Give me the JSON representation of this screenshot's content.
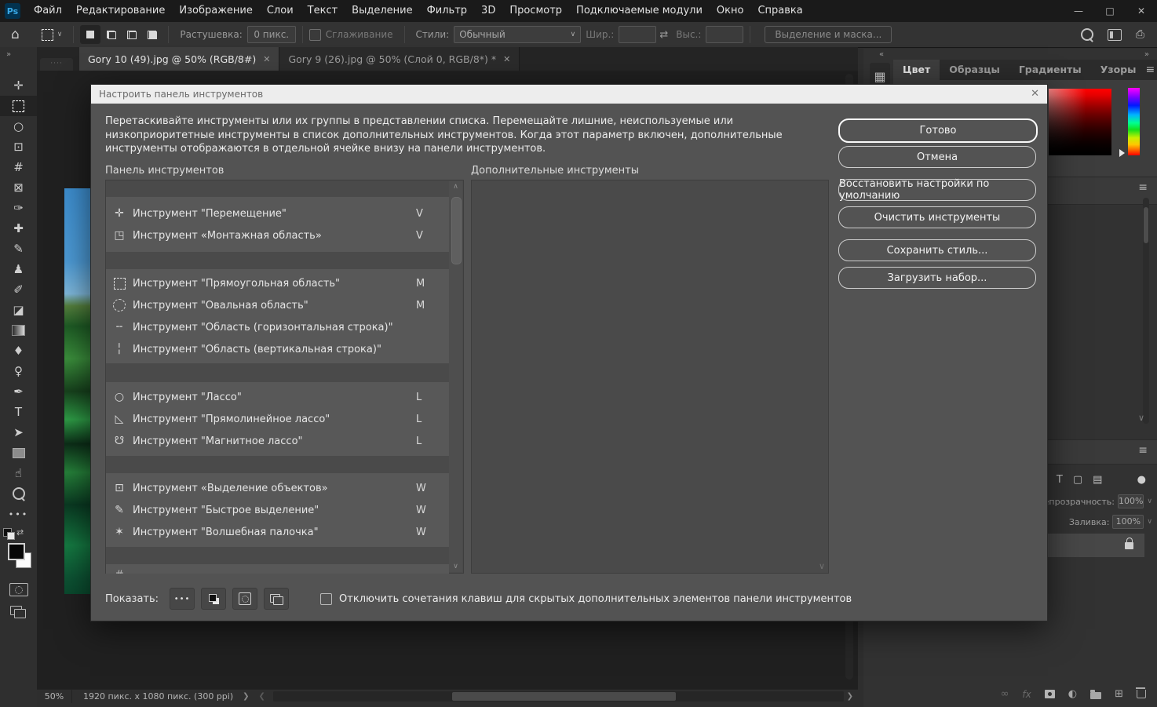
{
  "titlebar": {
    "logo": "Ps",
    "menus": [
      "Файл",
      "Редактирование",
      "Изображение",
      "Слои",
      "Текст",
      "Выделение",
      "Фильтр",
      "3D",
      "Просмотр",
      "Подключаемые модули",
      "Окно",
      "Справка"
    ],
    "window": {
      "minimize": "—",
      "maximize": "□",
      "close": "✕"
    }
  },
  "options": {
    "feather_label": "Растушевка:",
    "feather_value": "0 пикс.",
    "smooth_label": "Сглаживание",
    "styles_label": "Стили:",
    "styles_value": "Обычный",
    "width_label": "Шир.:",
    "height_label": "Выс.:",
    "select_mask_label": "Выделение и маска..."
  },
  "tabs": [
    {
      "title": "Gory 10 (49).jpg @ 50% (RGB/8#)",
      "close": "✕"
    },
    {
      "title": "Gory 9 (26).jpg @ 50% (Слой 0, RGB/8*) *",
      "close": "✕"
    }
  ],
  "sidebar": {
    "tools": [
      {
        "icon": "move-tool-icon",
        "glyph": "✛"
      },
      {
        "icon": "rectangular-marquee-tool-icon",
        "glyph": ""
      },
      {
        "icon": "lasso-tool-icon",
        "glyph": "○"
      },
      {
        "icon": "object-selection-tool-icon",
        "glyph": "⊡"
      },
      {
        "icon": "crop-tool-icon",
        "glyph": "#"
      },
      {
        "icon": "frame-tool-icon",
        "glyph": "⊠"
      },
      {
        "icon": "eyedropper-tool-icon",
        "glyph": "✑"
      },
      {
        "icon": "healing-brush-tool-icon",
        "glyph": "✚"
      },
      {
        "icon": "brush-tool-icon",
        "glyph": "✎"
      },
      {
        "icon": "clone-stamp-tool-icon",
        "glyph": "♟"
      },
      {
        "icon": "history-brush-tool-icon",
        "glyph": "✐"
      },
      {
        "icon": "eraser-tool-icon",
        "glyph": "◪"
      },
      {
        "icon": "gradient-tool-icon",
        "glyph": ""
      },
      {
        "icon": "blur-tool-icon",
        "glyph": "♦"
      },
      {
        "icon": "dodge-tool-icon",
        "glyph": "♀"
      },
      {
        "icon": "pen-tool-icon",
        "glyph": "✒"
      },
      {
        "icon": "type-tool-icon",
        "glyph": "T"
      },
      {
        "icon": "path-select-tool-icon",
        "glyph": "➤"
      },
      {
        "icon": "shape-tool-icon",
        "glyph": ""
      },
      {
        "icon": "hand-tool-icon",
        "glyph": "☝"
      },
      {
        "icon": "zoom-tool-icon",
        "glyph": ""
      },
      {
        "icon": "edit-toolbar-icon",
        "glyph": "•••"
      }
    ]
  },
  "dialog": {
    "title": "Настроить панель инструментов",
    "close": "✕",
    "description": "Перетаскивайте инструменты или их группы в представлении списка. Перемещайте лишние, неиспользуемые или низкоприоритетные инструменты в список дополнительных инструментов. Когда этот параметр включен, дополнительные инструменты отображаются в отдельной ячейке внизу на панели инструментов.",
    "toolbar_column_label": "Панель инструментов",
    "extra_column_label": "Дополнительные инструменты",
    "groups": [
      {
        "rows": [
          {
            "icon": "move-tool-icon",
            "glyph": "✛",
            "label": "Инструмент \"Перемещение\"",
            "key": "V"
          },
          {
            "icon": "artboard-tool-icon",
            "glyph": "◳",
            "label": "Инструмент «Монтажная область»",
            "key": "V"
          }
        ]
      },
      {
        "rows": [
          {
            "icon": "rectangular-marquee-icon",
            "glyph": "",
            "label": "Инструмент \"Прямоугольная область\"",
            "key": "M"
          },
          {
            "icon": "elliptical-marquee-icon",
            "glyph": "",
            "label": "Инструмент \"Овальная область\"",
            "key": "M"
          },
          {
            "icon": "single-row-marquee-icon",
            "glyph": "╌",
            "label": "Инструмент \"Область (горизонтальная строка)\"",
            "key": ""
          },
          {
            "icon": "single-column-marquee-icon",
            "glyph": "╎",
            "label": "Инструмент \"Область (вертикальная строка)\"",
            "key": ""
          }
        ]
      },
      {
        "rows": [
          {
            "icon": "lasso-icon",
            "glyph": "○",
            "label": "Инструмент \"Лассо\"",
            "key": "L"
          },
          {
            "icon": "polygonal-lasso-icon",
            "glyph": "◺",
            "label": "Инструмент \"Прямолинейное лассо\"",
            "key": "L"
          },
          {
            "icon": "magnetic-lasso-icon",
            "glyph": "☋",
            "label": "Инструмент \"Магнитное лассо\"",
            "key": "L"
          }
        ]
      },
      {
        "rows": [
          {
            "icon": "object-selection-icon",
            "glyph": "⊡",
            "label": "Инструмент «Выделение объектов»",
            "key": "W"
          },
          {
            "icon": "quick-selection-icon",
            "glyph": "✎",
            "label": "Инструмент \"Быстрое выделение\"",
            "key": "W"
          },
          {
            "icon": "magic-wand-icon",
            "glyph": "✶",
            "label": "Инструмент \"Волшебная палочка\"",
            "key": "W"
          }
        ]
      },
      {
        "rows": [
          {
            "icon": "crop-group-partial-icon",
            "glyph": "#",
            "label": "",
            "key": ""
          }
        ]
      }
    ],
    "show_label": "Показать:",
    "checkbox_label": "Отключить сочетания клавиш для скрытых дополнительных элементов панели инструментов",
    "buttons": [
      "Готово",
      "Отмена",
      "Восстановить настройки по умолчанию",
      "Очистить инструменты",
      "Сохранить стиль...",
      "Загрузить набор..."
    ]
  },
  "rightdock": {
    "collapse_chevrons": "«",
    "expand_chevrons": "»",
    "panel_tabs": [
      "Цвет",
      "Образцы",
      "Градиенты",
      "Узоры"
    ],
    "layers": {
      "opacity_label": "Непрозрачность:",
      "opacity_value": "100%",
      "fill_label": "Заливка:",
      "fill_value": "100%"
    }
  },
  "status": {
    "zoom": "50%",
    "doc_info": "1920 пикс. x 1080 пикс. (300 ppi)"
  }
}
